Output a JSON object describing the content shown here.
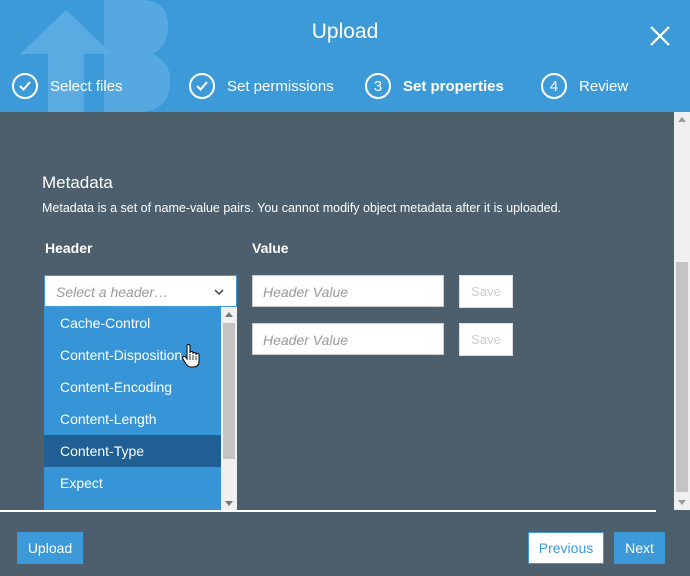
{
  "header": {
    "title": "Upload",
    "steps": [
      {
        "label": "Select files",
        "marker": "",
        "state": "done"
      },
      {
        "label": "Set permissions",
        "marker": "",
        "state": "done"
      },
      {
        "label": "Set properties",
        "marker": "3",
        "state": "active"
      },
      {
        "label": "Review",
        "marker": "4",
        "state": "pending"
      }
    ]
  },
  "metadata": {
    "title": "Metadata",
    "description": "Metadata is a set of name-value pairs. You cannot modify object metadata after it is uploaded.",
    "header_column": "Header",
    "value_column": "Value",
    "select_placeholder": "Select a header…",
    "rows": [
      {
        "value_placeholder": "Header Value",
        "save_label": "Save"
      },
      {
        "value_placeholder": "Header Value",
        "save_label": "Save"
      }
    ],
    "dropdown_options": [
      "Cache-Control",
      "Content-Disposition",
      "Content-Encoding",
      "Content-Length",
      "Content-Type",
      "Expect"
    ],
    "hovered_option": "Content-Type"
  },
  "footer": {
    "upload_label": "Upload",
    "previous_label": "Previous",
    "next_label": "Next"
  },
  "colors": {
    "accent": "#3d9ad8",
    "panel_bg": "#4d5f6c",
    "dropdown_bg": "#3794d6",
    "dropdown_hover": "#1f5f94"
  }
}
